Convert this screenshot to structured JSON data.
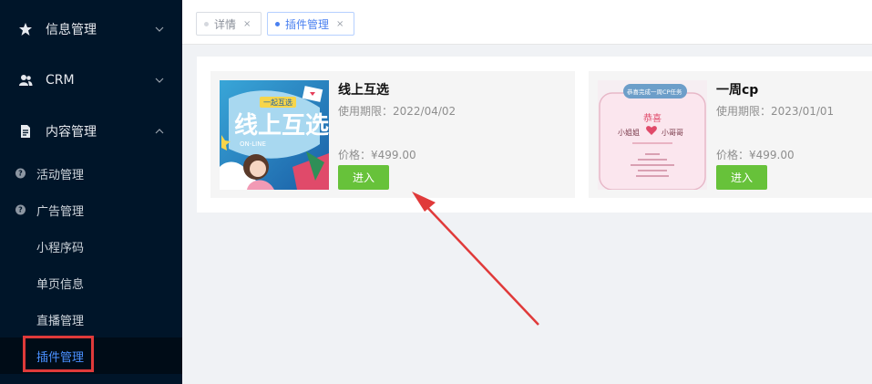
{
  "sidebar": {
    "groups": [
      {
        "label": "信息管理",
        "icon": "star-icon"
      },
      {
        "label": "CRM",
        "icon": "users-icon"
      },
      {
        "label": "内容管理",
        "icon": "document-icon"
      }
    ],
    "items": [
      {
        "label": "活动管理",
        "icon": "question-circle-icon"
      },
      {
        "label": "广告管理",
        "icon": "question-circle-icon"
      },
      {
        "label": "小程序码"
      },
      {
        "label": "单页信息"
      },
      {
        "label": "直播管理"
      },
      {
        "label": "插件管理",
        "active": true
      }
    ]
  },
  "tabs": [
    {
      "label": "详情",
      "close": "×"
    },
    {
      "label": "插件管理",
      "close": "×",
      "active": true
    }
  ],
  "plugins": [
    {
      "name": "线上互选",
      "expiry": "使用期限：2022/04/02",
      "price": "价格：¥499.00",
      "button": "进入",
      "thumb": {
        "big_text": "线上互选",
        "ribbon": "一起互选",
        "sub": "ON-LINE"
      }
    },
    {
      "name": "一周cp",
      "expiry": "使用期限：2023/01/01",
      "price": "价格：¥499.00",
      "button": "进入",
      "thumb": {
        "header": "恭喜完成一周CP任务",
        "title": "恭喜",
        "left": "小姐姐",
        "right": "小哥哥"
      }
    }
  ],
  "colors": {
    "sidebar_bg": "#001529",
    "active_text": "#4a90ff",
    "enter_button": "#67c23a",
    "annotation": "#e03a3a"
  }
}
